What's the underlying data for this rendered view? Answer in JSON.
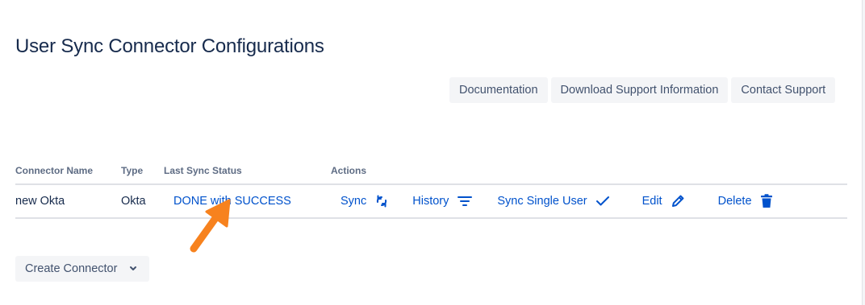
{
  "page": {
    "title": "User Sync Connector Configurations"
  },
  "toolbar": {
    "documentation_label": "Documentation",
    "download_support_label": "Download Support Information",
    "contact_support_label": "Contact Support"
  },
  "table": {
    "columns": [
      "Connector Name",
      "Type",
      "Last Sync Status",
      "Actions"
    ],
    "rows": [
      {
        "name": "new Okta",
        "type": "Okta",
        "status": "DONE with SUCCESS",
        "actions": {
          "sync": "Sync",
          "history": "History",
          "sync_single_user": "Sync Single User",
          "edit": "Edit",
          "delete": "Delete"
        }
      }
    ]
  },
  "icons": {
    "sync": "sync-icon",
    "history": "filter-icon",
    "sync_single_user": "check-icon",
    "edit": "pencil-icon",
    "delete": "trash-icon",
    "annotation": "arrow-icon",
    "dropdown": "chevron-down-icon"
  },
  "colors": {
    "link": "#0052cc",
    "annotation_arrow": "#f7821e",
    "button_bg": "#f4f5f7",
    "text": "#172b4d"
  },
  "create_connector": {
    "label": "Create Connector"
  }
}
